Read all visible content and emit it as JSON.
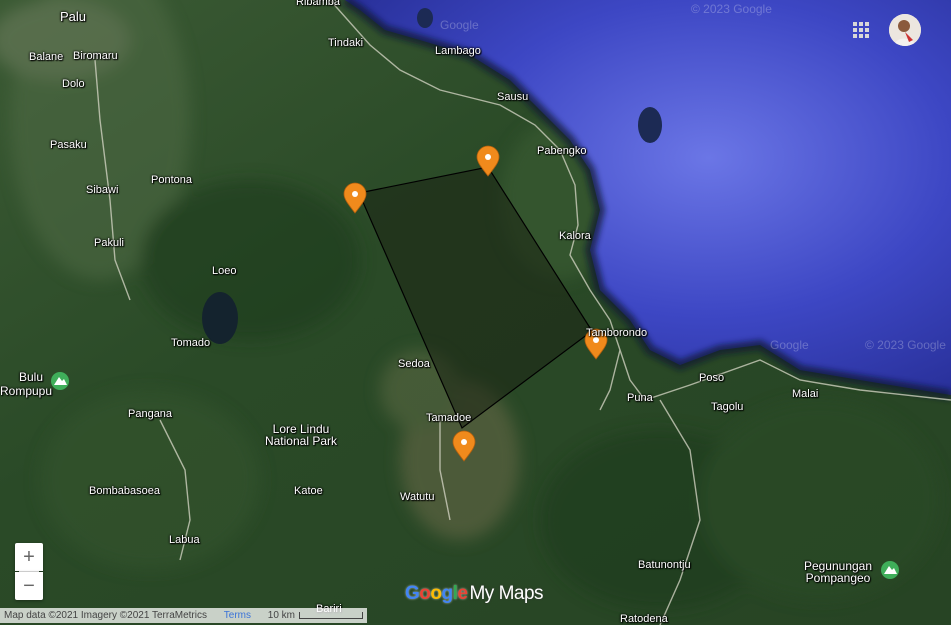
{
  "map": {
    "places": [
      {
        "name": "Palu"
      },
      {
        "name": "Ribamba"
      },
      {
        "name": "Tindaki"
      },
      {
        "name": "Lambago"
      },
      {
        "name": "Balane"
      },
      {
        "name": "Biromaru"
      },
      {
        "name": "Dolo"
      },
      {
        "name": "Sausu"
      },
      {
        "name": "Pabengko"
      },
      {
        "name": "Pasaku"
      },
      {
        "name": "Pontona"
      },
      {
        "name": "Sibawi"
      },
      {
        "name": "Kalora"
      },
      {
        "name": "Pakuli"
      },
      {
        "name": "Loeo"
      },
      {
        "name": "Tomado"
      },
      {
        "name": "Tamborondo"
      },
      {
        "name": "Sedoa"
      },
      {
        "name": "Poso"
      },
      {
        "name": "Bulu"
      },
      {
        "name": "Rompupu"
      },
      {
        "name": "Puna"
      },
      {
        "name": "Malai"
      },
      {
        "name": "Tagolu"
      },
      {
        "name": "Pangana"
      },
      {
        "name": "Tamadoe"
      },
      {
        "name": "Katoe"
      },
      {
        "name": "Bombabasoea"
      },
      {
        "name": "Watutu"
      },
      {
        "name": "Labua"
      },
      {
        "name": "Batunontju"
      },
      {
        "name": "Bariri"
      },
      {
        "name": "Ratodena"
      }
    ],
    "park_label_line1": "Lore Lindu",
    "park_label_line2": "National Park",
    "mountain_label_line1": "Pegunungan",
    "mountain_label_line2": "Pompangeo",
    "watermark": "© 2023 Google",
    "watermark_google": "Google"
  },
  "controls": {
    "zoom_in": "+",
    "zoom_out": "−"
  },
  "attribution": {
    "data": "Map data ©2021 Imagery ©2021 TerraMetrics",
    "terms": "Terms",
    "scale": "10 km"
  },
  "logo": {
    "google": "Google",
    "mymaps": "My Maps",
    "colors": [
      "#4285F4",
      "#EA4335",
      "#FBBC05",
      "#4285F4",
      "#34A853",
      "#EA4335"
    ]
  },
  "colors": {
    "sea": "#3a43c8",
    "land": "#2d4f2a",
    "marker": "#f08a1c",
    "polygon_fill": "#1b2414",
    "polygon_stroke": "#000000"
  },
  "icons": {
    "marker": "map-pin-icon",
    "apps": "apps-grid-icon",
    "mountain": "mountain-icon",
    "avatar": "user-avatar"
  }
}
